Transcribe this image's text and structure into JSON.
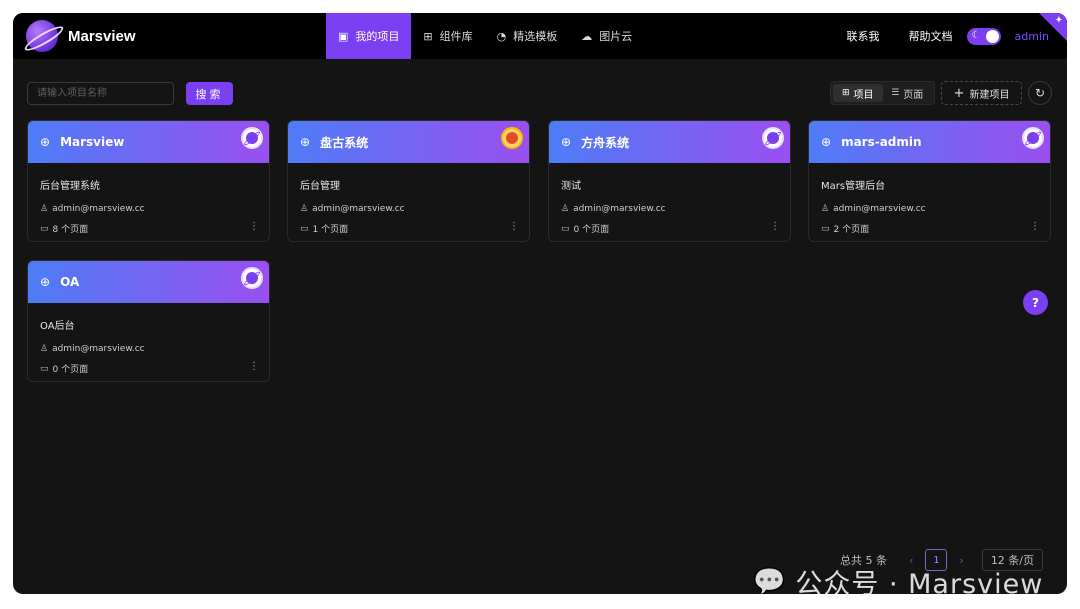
{
  "app": {
    "name": "Marsview",
    "logo_icon": "planet-logo-icon"
  },
  "nav": [
    {
      "label": "我的项目",
      "icon": "project-icon",
      "active": true
    },
    {
      "label": "组件库",
      "icon": "grid-icon",
      "active": false
    },
    {
      "label": "精选模板",
      "icon": "pie-icon",
      "active": false
    },
    {
      "label": "图片云",
      "icon": "cloud-icon",
      "active": false
    }
  ],
  "header_right": {
    "contact": "联系我",
    "help": "帮助文档",
    "user": "admin"
  },
  "toolbar": {
    "search_placeholder": "请输入项目名称",
    "search_value": "",
    "search_label": "搜索",
    "view_project": "项目",
    "view_page": "页面",
    "new_project": "新建项目"
  },
  "cards": [
    {
      "name": "Marsview",
      "desc": "后台管理系统",
      "owner": "admin@marsview.cc",
      "pages": "8 个页面",
      "logo": "planet"
    },
    {
      "name": "盘古系统",
      "desc": "后台管理",
      "owner": "admin@marsview.cc",
      "pages": "1 个页面",
      "logo": "custom"
    },
    {
      "name": "方舟系统",
      "desc": "测试",
      "owner": "admin@marsview.cc",
      "pages": "0 个页面",
      "logo": "planet"
    },
    {
      "name": "mars-admin",
      "desc": "Mars管理后台",
      "owner": "admin@marsview.cc",
      "pages": "2 个页面",
      "logo": "planet"
    },
    {
      "name": "OA",
      "desc": "OA后台",
      "owner": "admin@marsview.cc",
      "pages": "0 个页面",
      "logo": "planet"
    }
  ],
  "pagination": {
    "total": "总共 5 条",
    "current": "1",
    "page_size": "12 条/页"
  },
  "watermark": {
    "text": "公众号 · Marsview"
  },
  "colors": {
    "accent": "#7b3ff2",
    "background": "#141414",
    "header": "#000000"
  }
}
